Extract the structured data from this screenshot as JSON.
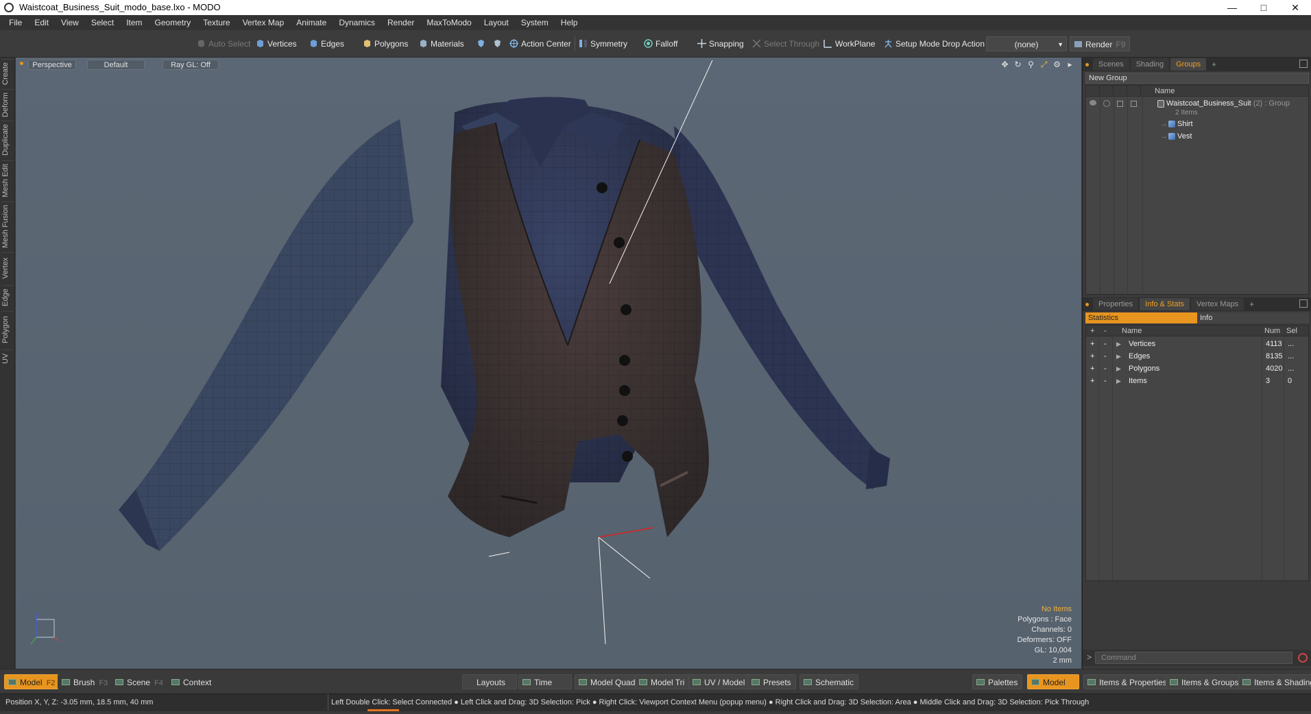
{
  "window": {
    "title": "Waistcoat_Business_Suit_modo_base.lxo - MODO"
  },
  "menu": [
    "File",
    "Edit",
    "View",
    "Select",
    "Item",
    "Geometry",
    "Texture",
    "Vertex Map",
    "Animate",
    "Dynamics",
    "Render",
    "MaxToModo",
    "Layout",
    "System",
    "Help"
  ],
  "toolbar": {
    "auto_select": "Auto Select",
    "vertices": "Vertices",
    "edges": "Edges",
    "polygons": "Polygons",
    "materials": "Materials",
    "action_center": "Action Center",
    "symmetry": "Symmetry",
    "falloff": "Falloff",
    "snapping": "Snapping",
    "select_through": "Select Through",
    "workplane": "WorkPlane",
    "setup_mode": "Setup Mode",
    "drop_action": "Drop Action",
    "drop_action_value": "(none)",
    "render": "Render",
    "render_key": "F9"
  },
  "left_tabs": [
    "Create",
    "Deform",
    "Duplicate",
    "Mesh Edit",
    "Mesh Fusion",
    "Vertex",
    "Edge",
    "Polygon",
    "UV"
  ],
  "viewport": {
    "view": "Perspective",
    "shading": "Default",
    "raygl": "Ray GL: Off",
    "overlay": {
      "no_items": "No Items",
      "polygons": "Polygons : Face",
      "channels": "Channels: 0",
      "deformers": "Deformers: OFF",
      "gl": "GL: 10,004",
      "scale": "2 mm"
    }
  },
  "top_panel": {
    "tabs": [
      "Scenes",
      "Shading",
      "Groups"
    ],
    "active_tab": "Groups",
    "new_group": "New Group",
    "name_header": "Name",
    "tree": {
      "group_name": "Waistcoat_Business_Suit",
      "group_suffix": "(2) : Group",
      "group_count": "2 Items",
      "children": [
        "Shirt",
        "Vest"
      ]
    }
  },
  "bottom_panel": {
    "tabs": [
      "Properties",
      "Info & Stats",
      "Vertex Maps"
    ],
    "active_tab": "Info & Stats",
    "subtabs": [
      "Statistics",
      "Info"
    ],
    "headers": {
      "plus": "+",
      "minus": "-",
      "name": "Name",
      "num": "Num",
      "sel": "Sel"
    },
    "rows": [
      {
        "name": "Vertices",
        "num": "4113",
        "sel": "..."
      },
      {
        "name": "Edges",
        "num": "8135",
        "sel": "..."
      },
      {
        "name": "Polygons",
        "num": "4020",
        "sel": "..."
      },
      {
        "name": "Items",
        "num": "3",
        "sel": "0"
      }
    ]
  },
  "command": {
    "prompt": ">",
    "placeholder": "Command"
  },
  "bottombar": {
    "model": "Model",
    "model_key": "F2",
    "brush": "Brush",
    "brush_key": "F3",
    "scene": "Scene",
    "scene_key": "F4",
    "context": "Context",
    "layouts": "Layouts",
    "time": "Time",
    "model_quad": "Model Quad",
    "model_tri": "Model Tri",
    "uv_model": "UV / Model",
    "presets": "Presets",
    "schematic": "Schematic",
    "palettes": "Palettes",
    "model_right": "Model",
    "items_properties": "Items & Properties",
    "items_groups": "Items & Groups",
    "items_shading": "Items & Shading"
  },
  "status": {
    "position": "Position X, Y, Z:  -3.05 mm, 18.5 mm, 40 mm",
    "hint": "Left Double Click: Select Connected ● Left Click and Drag: 3D Selection: Pick ● Right Click: Viewport Context Menu (popup menu) ● Right Click and Drag: 3D Selection: Area ● Middle Click and Drag: 3D Selection: Pick Through"
  },
  "colors": {
    "accent": "#e8951f",
    "viewport_bg": "#5b6774",
    "vest": "#3b3232",
    "shirt": "#2c3550"
  }
}
